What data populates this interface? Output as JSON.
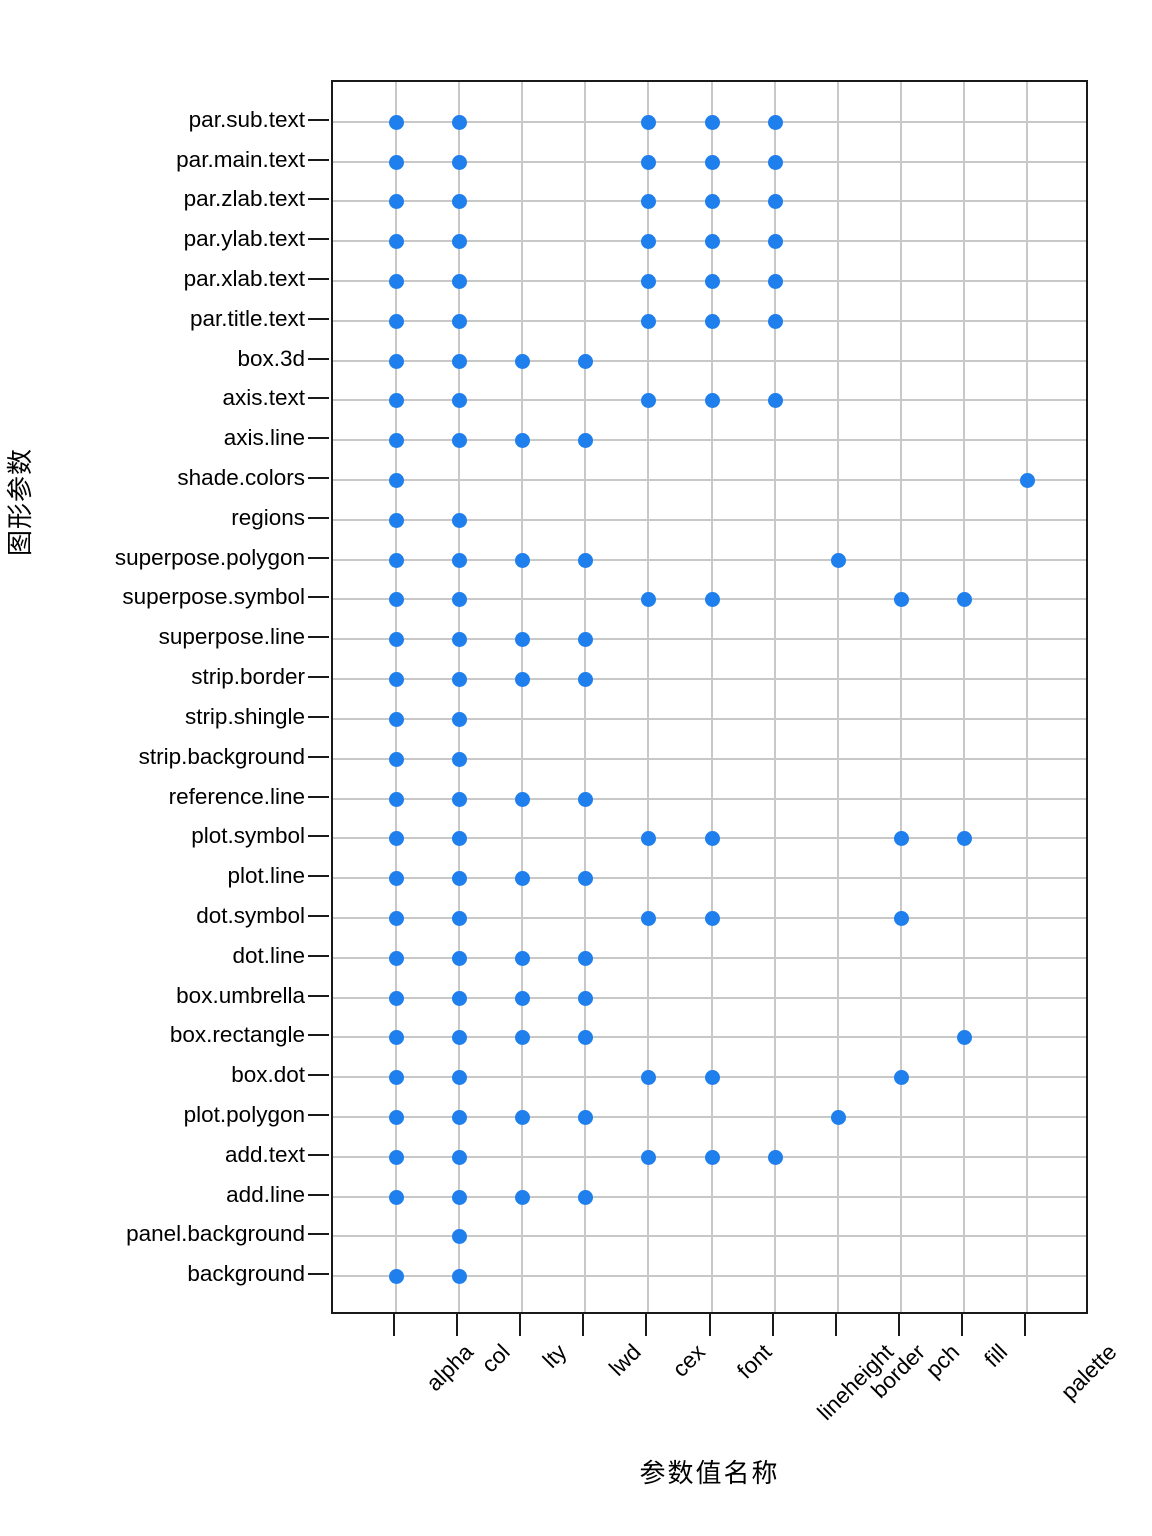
{
  "chart_data": {
    "type": "scatter",
    "title": "",
    "subtitle": "",
    "xlabel": "参数值名称",
    "ylabel": "图形参数",
    "grid": true,
    "legend": false,
    "point_color": "#1f7fed",
    "x_categories": [
      "alpha",
      "col",
      "lty",
      "lwd",
      "cex",
      "font",
      "lineheight",
      "border",
      "pch",
      "fill",
      "palette"
    ],
    "y_categories": [
      "par.sub.text",
      "par.main.text",
      "par.zlab.text",
      "par.ylab.text",
      "par.xlab.text",
      "par.title.text",
      "box.3d",
      "axis.text",
      "axis.line",
      "shade.colors",
      "regions",
      "superpose.polygon",
      "superpose.symbol",
      "superpose.line",
      "strip.border",
      "strip.shingle",
      "strip.background",
      "reference.line",
      "plot.symbol",
      "plot.line",
      "dot.symbol",
      "dot.line",
      "box.umbrella",
      "box.rectangle",
      "box.dot",
      "plot.polygon",
      "add.text",
      "add.line",
      "panel.background",
      "background"
    ],
    "points": [
      {
        "y": "par.sub.text",
        "x": [
          "alpha",
          "col",
          "cex",
          "font",
          "lineheight"
        ]
      },
      {
        "y": "par.main.text",
        "x": [
          "alpha",
          "col",
          "cex",
          "font",
          "lineheight"
        ]
      },
      {
        "y": "par.zlab.text",
        "x": [
          "alpha",
          "col",
          "cex",
          "font",
          "lineheight"
        ]
      },
      {
        "y": "par.ylab.text",
        "x": [
          "alpha",
          "col",
          "cex",
          "font",
          "lineheight"
        ]
      },
      {
        "y": "par.xlab.text",
        "x": [
          "alpha",
          "col",
          "cex",
          "font",
          "lineheight"
        ]
      },
      {
        "y": "par.title.text",
        "x": [
          "alpha",
          "col",
          "cex",
          "font",
          "lineheight"
        ]
      },
      {
        "y": "box.3d",
        "x": [
          "alpha",
          "col",
          "lty",
          "lwd"
        ]
      },
      {
        "y": "axis.text",
        "x": [
          "alpha",
          "col",
          "cex",
          "font",
          "lineheight"
        ]
      },
      {
        "y": "axis.line",
        "x": [
          "alpha",
          "col",
          "lty",
          "lwd"
        ]
      },
      {
        "y": "shade.colors",
        "x": [
          "alpha",
          "palette"
        ]
      },
      {
        "y": "regions",
        "x": [
          "alpha",
          "col"
        ]
      },
      {
        "y": "superpose.polygon",
        "x": [
          "alpha",
          "col",
          "lty",
          "lwd",
          "border"
        ]
      },
      {
        "y": "superpose.symbol",
        "x": [
          "alpha",
          "col",
          "cex",
          "font",
          "pch",
          "fill"
        ]
      },
      {
        "y": "superpose.line",
        "x": [
          "alpha",
          "col",
          "lty",
          "lwd"
        ]
      },
      {
        "y": "strip.border",
        "x": [
          "alpha",
          "col",
          "lty",
          "lwd"
        ]
      },
      {
        "y": "strip.shingle",
        "x": [
          "alpha",
          "col"
        ]
      },
      {
        "y": "strip.background",
        "x": [
          "alpha",
          "col"
        ]
      },
      {
        "y": "reference.line",
        "x": [
          "alpha",
          "col",
          "lty",
          "lwd"
        ]
      },
      {
        "y": "plot.symbol",
        "x": [
          "alpha",
          "col",
          "cex",
          "font",
          "pch",
          "fill"
        ]
      },
      {
        "y": "plot.line",
        "x": [
          "alpha",
          "col",
          "lty",
          "lwd"
        ]
      },
      {
        "y": "dot.symbol",
        "x": [
          "alpha",
          "col",
          "cex",
          "font",
          "pch"
        ]
      },
      {
        "y": "dot.line",
        "x": [
          "alpha",
          "col",
          "lty",
          "lwd"
        ]
      },
      {
        "y": "box.umbrella",
        "x": [
          "alpha",
          "col",
          "lty",
          "lwd"
        ]
      },
      {
        "y": "box.rectangle",
        "x": [
          "alpha",
          "col",
          "lty",
          "lwd",
          "fill"
        ]
      },
      {
        "y": "box.dot",
        "x": [
          "alpha",
          "col",
          "cex",
          "font",
          "pch"
        ]
      },
      {
        "y": "plot.polygon",
        "x": [
          "alpha",
          "col",
          "lty",
          "lwd",
          "border"
        ]
      },
      {
        "y": "add.text",
        "x": [
          "alpha",
          "col",
          "cex",
          "font",
          "lineheight"
        ]
      },
      {
        "y": "add.line",
        "x": [
          "alpha",
          "col",
          "lty",
          "lwd"
        ]
      },
      {
        "y": "panel.background",
        "x": [
          "col"
        ]
      },
      {
        "y": "background",
        "x": [
          "alpha",
          "col"
        ]
      }
    ]
  }
}
